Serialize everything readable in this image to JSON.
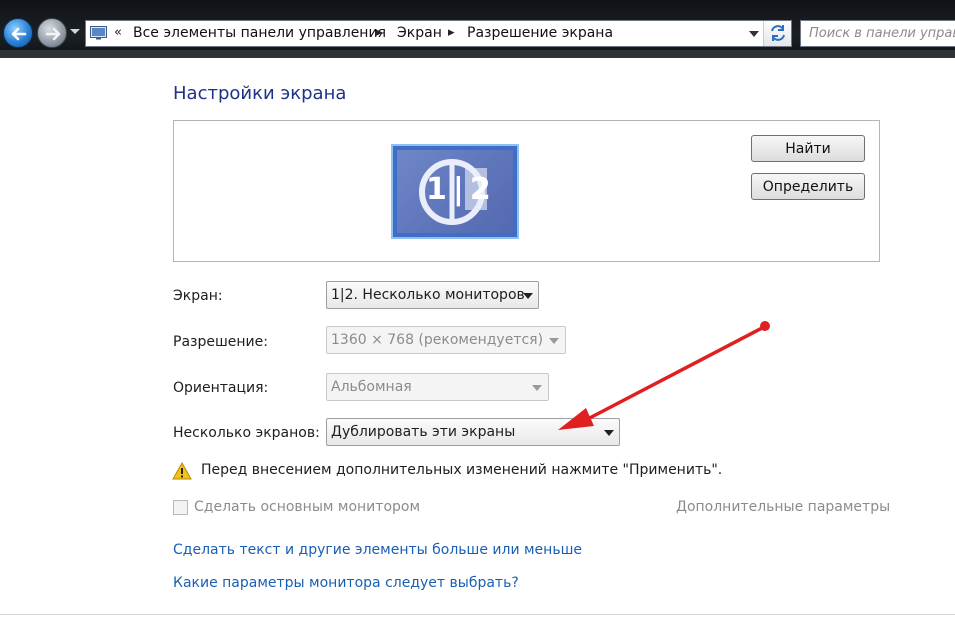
{
  "address_bar": {
    "breadcrumbs": [
      "Все элементы панели управления",
      "Экран",
      "Разрешение экрана"
    ],
    "overflow_marker": "«"
  },
  "search": {
    "placeholder": "Поиск в панели управ"
  },
  "page": {
    "title": "Настройки экрана",
    "monitor_icon_label": "1|2",
    "buttons": {
      "find": "Найти",
      "identify": "Определить"
    }
  },
  "settings": {
    "display": {
      "label": "Экран:",
      "value": "1|2. Несколько мониторов"
    },
    "resolution": {
      "label": "Разрешение:",
      "value": "1360 × 768 (рекомендуется)"
    },
    "orientation": {
      "label": "Ориентация:",
      "value": "Альбомная"
    },
    "multiple_displays": {
      "label": "Несколько экранов:",
      "value": "Дублировать эти экраны"
    }
  },
  "warning": "Перед внесением дополнительных изменений нажмите \"Применить\".",
  "primary_monitor": {
    "label": "Сделать основным монитором",
    "checked": false
  },
  "advanced_link": "Дополнительные параметры",
  "links": [
    "Сделать текст и другие элементы больше или меньше",
    "Какие параметры монитора следует выбрать?"
  ],
  "colors": {
    "title": "#1e3287",
    "link": "#1a5fb4",
    "annotation_arrow": "#e02020",
    "disabled_text": "#8c8c8c"
  },
  "icons": {
    "back": "arrow-left-icon",
    "forward": "arrow-right-icon",
    "address": "control-panel-icon",
    "refresh": "refresh-icon",
    "warning": "warning-triangle-icon"
  }
}
